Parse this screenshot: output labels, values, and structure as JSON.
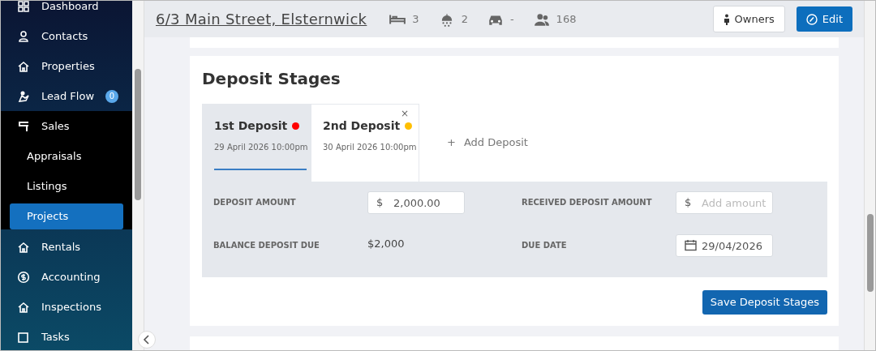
{
  "sidebar": {
    "items": [
      {
        "label": "Dashboard",
        "selected": false,
        "kind": "main"
      },
      {
        "label": "Contacts",
        "selected": false,
        "kind": "main"
      },
      {
        "label": "Properties",
        "selected": false,
        "kind": "main"
      },
      {
        "label": "Lead Flow",
        "selected": false,
        "kind": "main",
        "badge": "0"
      },
      {
        "label": "Sales",
        "selected": false,
        "kind": "group"
      },
      {
        "label": "Appraisals",
        "selected": false,
        "kind": "sub"
      },
      {
        "label": "Listings",
        "selected": false,
        "kind": "sub"
      },
      {
        "label": "Projects",
        "selected": true,
        "kind": "sub"
      },
      {
        "label": "Rentals",
        "selected": false,
        "kind": "main"
      },
      {
        "label": "Accounting",
        "selected": false,
        "kind": "main"
      },
      {
        "label": "Inspections",
        "selected": false,
        "kind": "main"
      },
      {
        "label": "Tasks",
        "selected": false,
        "kind": "main"
      }
    ]
  },
  "header": {
    "title": "6/3 Main Street, Elsternwick",
    "features": [
      "3",
      "2",
      "-",
      "168"
    ],
    "buttons": [
      {
        "label": "Owners",
        "kind": "light"
      },
      {
        "label": "Edit",
        "kind": "primary"
      }
    ]
  },
  "deposit_stages": {
    "title": "Deposit Stages",
    "tabs": [
      {
        "name": "1st Deposit",
        "date": "29 April 2026 10:00pm",
        "color": "#ff0000",
        "selected": true,
        "removable": false
      },
      {
        "name": "2nd Deposit",
        "date": "30 April 2026 10:00pm",
        "color": "#ffbf00",
        "selected": false,
        "removable": true
      }
    ],
    "close_symbol": "×",
    "add_button": {
      "icon": "+",
      "label": "Add Deposit"
    },
    "fields": [
      {
        "label": "DEPOSIT AMOUNT",
        "kind": "money",
        "prefix": "$",
        "value": "2,000.00"
      },
      {
        "label": "RECEIVED DEPOSIT AMOUNT",
        "kind": "money",
        "prefix": "$",
        "placeholder": "Add amount"
      },
      {
        "label": "BALANCE DEPOSIT DUE",
        "kind": "text",
        "value": "$2,000"
      },
      {
        "label": "DUE DATE",
        "kind": "date",
        "value": "29/04/2026"
      }
    ],
    "save_button": "Save Deposit Stages"
  }
}
